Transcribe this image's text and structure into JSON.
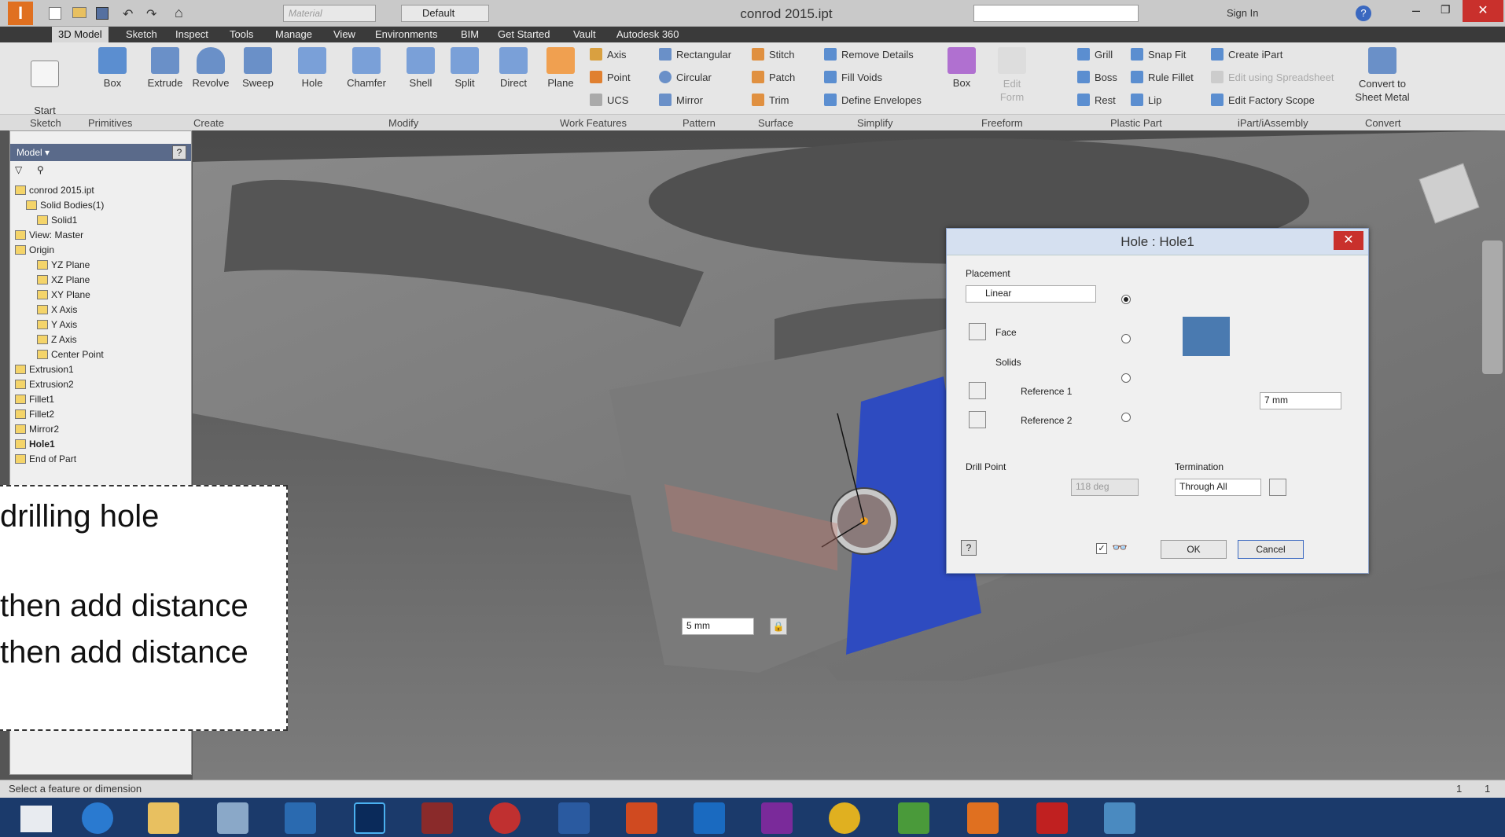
{
  "title": "conrod 2015.ipt",
  "quick_access": {
    "material_placeholder": "Material",
    "appearance": "Default",
    "sign_in": "Sign In"
  },
  "tabs": [
    "3D Model",
    "Sketch",
    "Inspect",
    "Tools",
    "Manage",
    "View",
    "Environments",
    "BIM",
    "Get Started",
    "Vault",
    "Autodesk 360"
  ],
  "ribbon": {
    "start_sketch": "Start\n2D Sketch",
    "box": "Box",
    "extrude": "Extrude",
    "revolve": "Revolve",
    "sweep": "Sweep",
    "hole": "Hole",
    "chamfer": "Chamfer",
    "shell": "Shell",
    "split": "Split",
    "direct": "Direct",
    "plane": "Plane",
    "axis": "Axis",
    "point": "Point",
    "ucs": "UCS",
    "rectangular": "Rectangular",
    "circular": "Circular",
    "mirror": "Mirror",
    "stitch": "Stitch",
    "patch": "Patch",
    "trim": "Trim",
    "remove_details": "Remove Details",
    "fill_voids": "Fill Voids",
    "define_envelopes": "Define Envelopes",
    "ff_box": "Box",
    "edit_form": "Edit\nForm",
    "grill": "Grill",
    "boss": "Boss",
    "rest": "Rest",
    "snap_fit": "Snap Fit",
    "rule_fillet": "Rule Fillet",
    "lip": "Lip",
    "create_ipart": "Create iPart",
    "edit_spreadsheet": "Edit using Spreadsheet",
    "edit_factory": "Edit Factory Scope",
    "convert": "Convert to\nSheet Metal"
  },
  "groups": [
    "Sketch",
    "Primitives",
    "Create",
    "Modify",
    "Work Features",
    "Pattern",
    "Surface",
    "Simplify",
    "Freeform",
    "Plastic Part",
    "iPart/iAssembly",
    "Convert"
  ],
  "browser": {
    "header": "Model",
    "nodes": [
      "conrod 2015.ipt",
      "Solid Bodies(1)",
      "Solid1",
      "View: Master",
      "Origin",
      "YZ Plane",
      "XZ Plane",
      "XY Plane",
      "X Axis",
      "Y Axis",
      "Z Axis",
      "Center Point",
      "Extrusion1",
      "Extrusion2",
      "Fillet1",
      "Fillet2",
      "Mirror2",
      "Hole1",
      "End of Part"
    ]
  },
  "dialog": {
    "title": "Hole : Hole1",
    "placement_label": "Placement",
    "placement_value": "Linear",
    "face": "Face",
    "solids": "Solids",
    "ref1": "Reference 1",
    "ref2": "Reference 2",
    "diameter": "7 mm",
    "drill_point_label": "Drill Point",
    "drill_angle": "118 deg",
    "termination_label": "Termination",
    "termination_value": "Through All",
    "ok": "OK",
    "cancel": "Cancel"
  },
  "viewport": {
    "distance_input": "5 mm"
  },
  "callout": {
    "line1": "drilling hole",
    "line2": "then add distance",
    "line3": "then add distance"
  },
  "status": {
    "text": "Select a feature or dimension",
    "right1": "1",
    "right2": "1"
  }
}
